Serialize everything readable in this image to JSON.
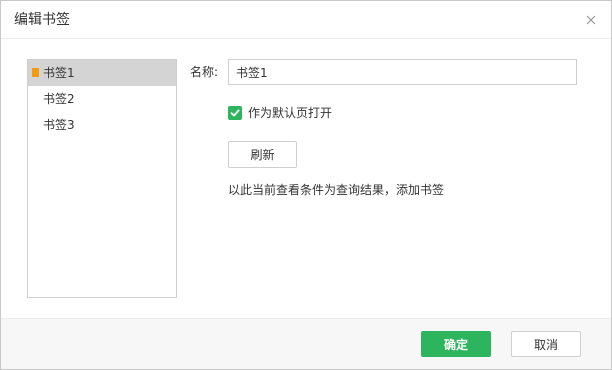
{
  "dialog": {
    "title": "编辑书签",
    "close_icon": "close-icon"
  },
  "bookmarks": {
    "items": [
      {
        "label": "书签1",
        "selected": true
      },
      {
        "label": "书签2",
        "selected": false
      },
      {
        "label": "书签3",
        "selected": false
      }
    ],
    "marker_color": "#f39c12",
    "selected_bg": "#d4d4d4"
  },
  "form": {
    "name_label": "名称:",
    "name_value": "书签1",
    "default_checked": true,
    "default_label": "作为默认页打开",
    "refresh_label": "刷新",
    "hint": "以此当前查看条件为查询结果，添加书签"
  },
  "footer": {
    "ok_label": "确定",
    "cancel_label": "取消"
  },
  "colors": {
    "accent": "#2db55d"
  }
}
